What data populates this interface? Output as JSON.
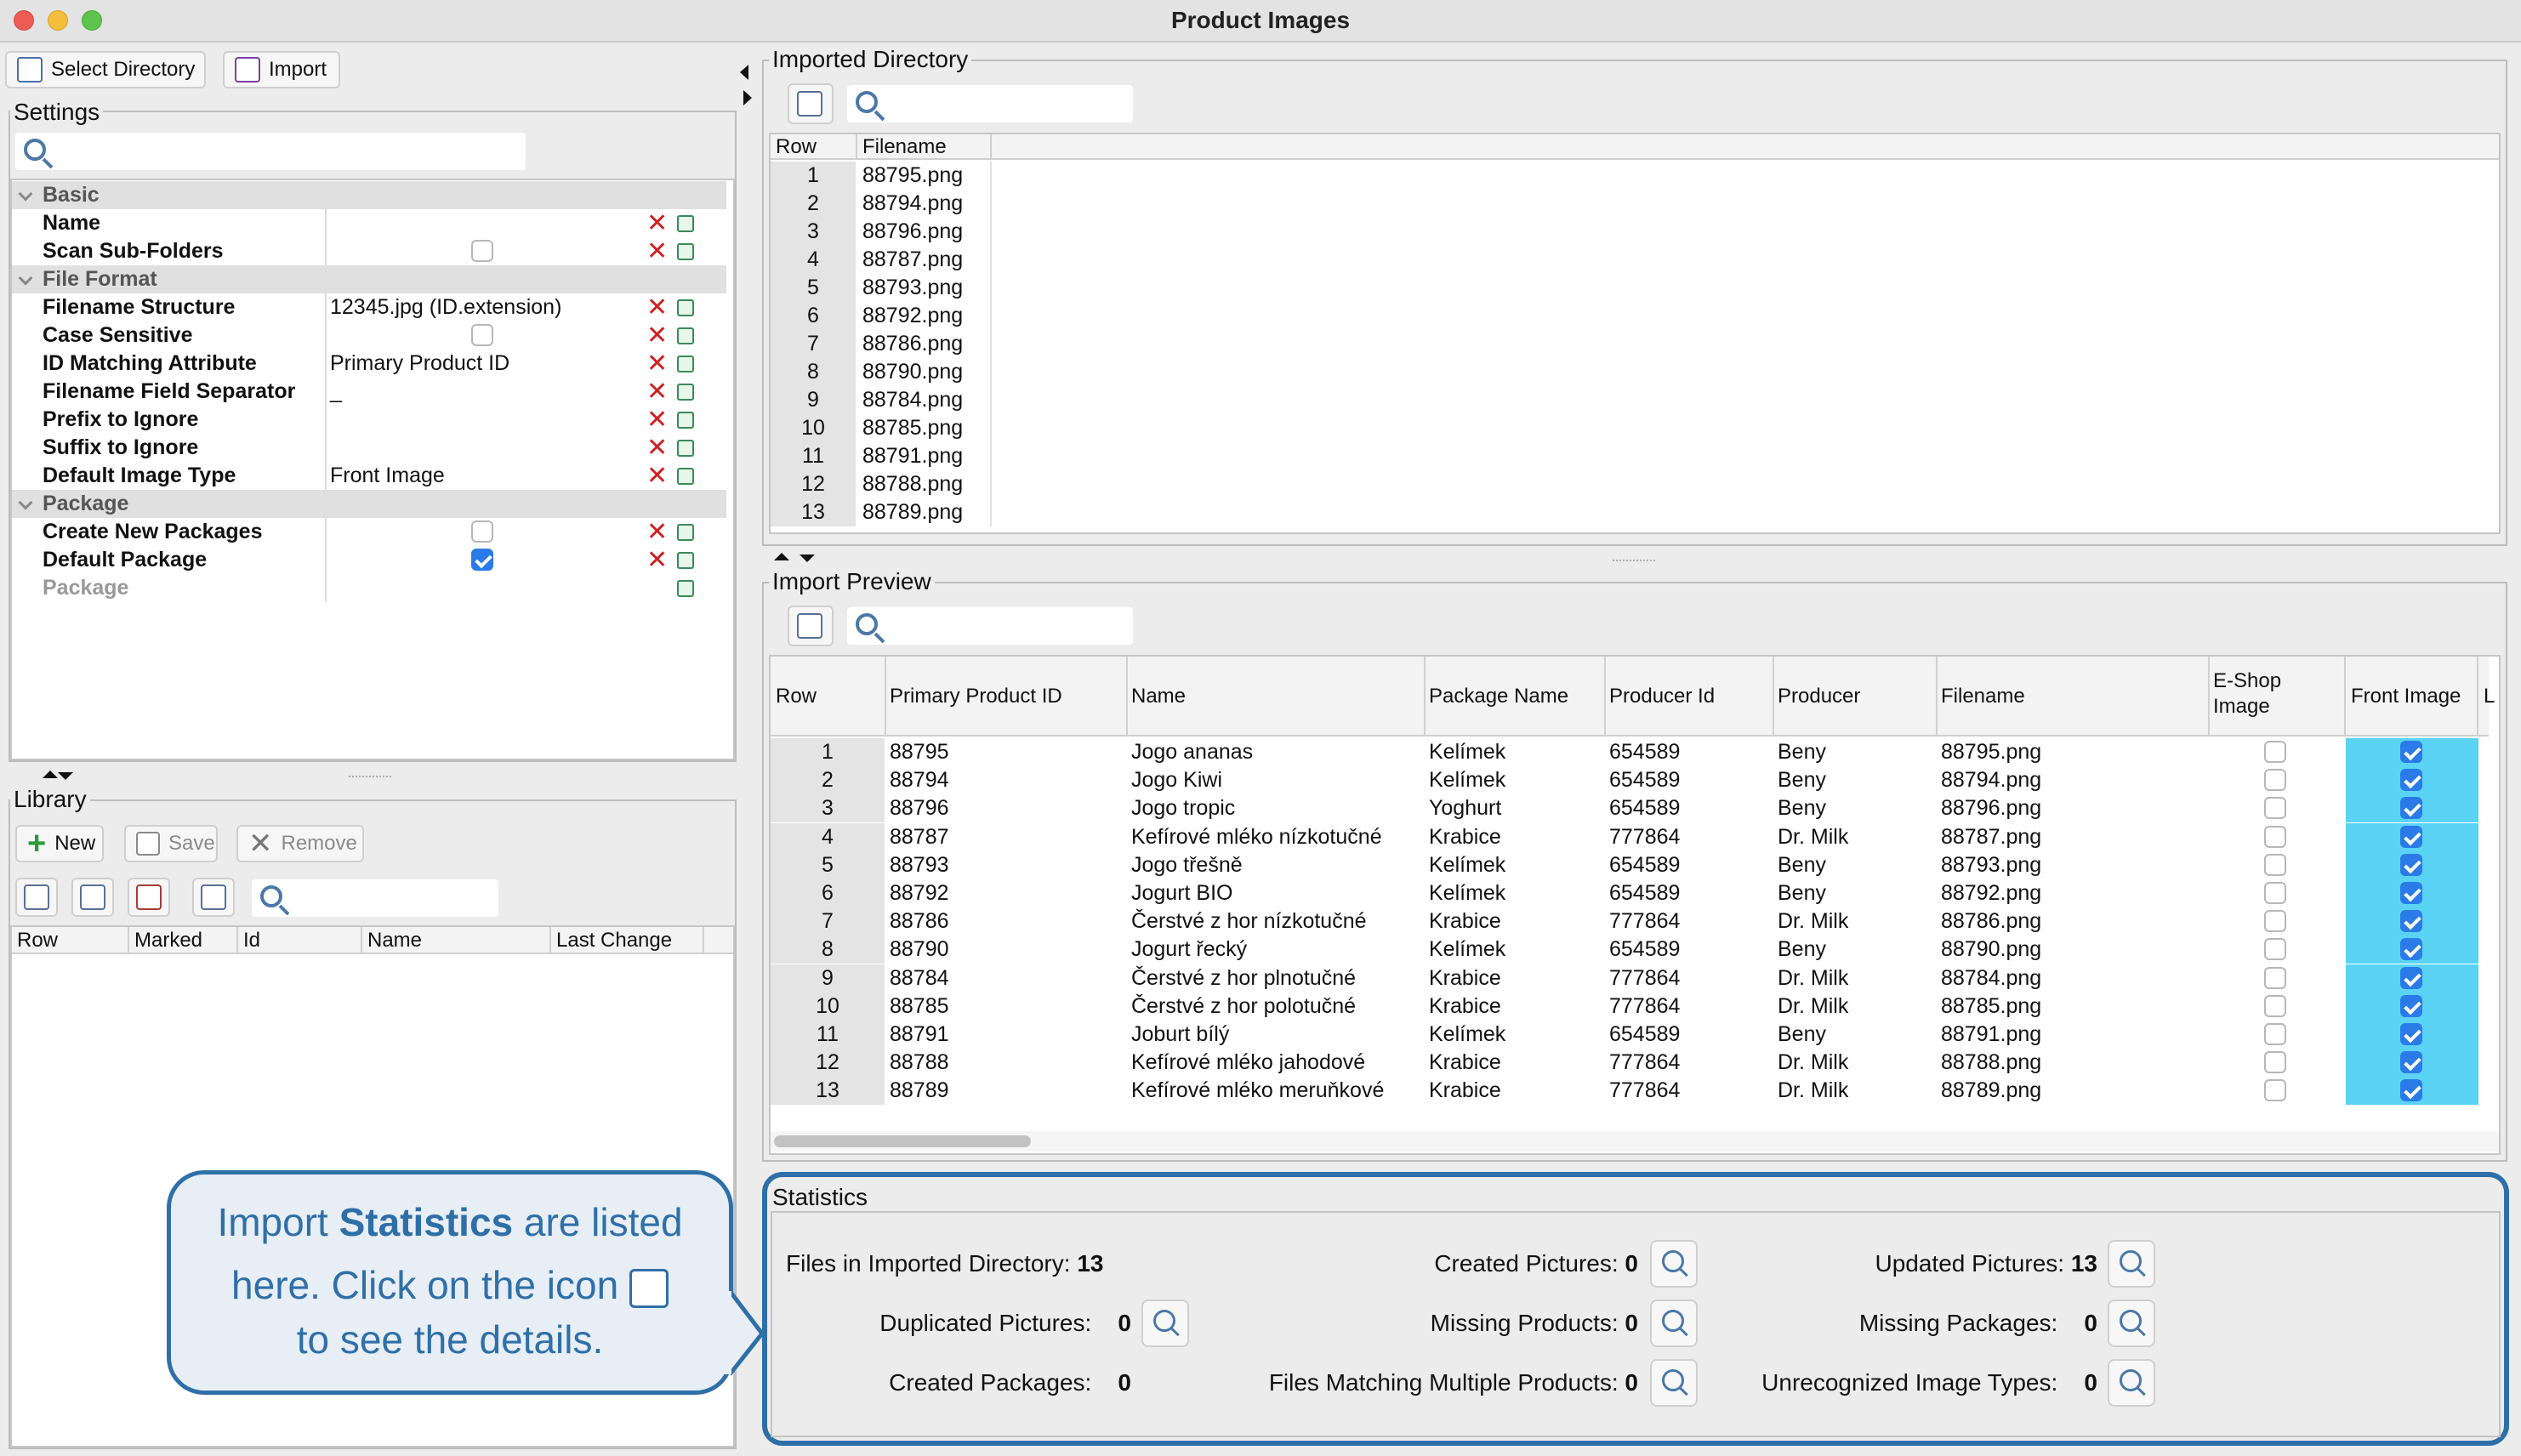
{
  "window": {
    "title": "Product Images"
  },
  "toolbar": {
    "select_directory": "Select Directory",
    "import": "Import"
  },
  "settings": {
    "title": "Settings",
    "categories": {
      "basic": "Basic",
      "file_format": "File Format",
      "package": "Package"
    },
    "rows": [
      {
        "label": "Name",
        "value": ""
      },
      {
        "label": "Scan Sub-Folders",
        "value": "",
        "checkbox": false
      },
      {
        "label": "Filename Structure",
        "value": "12345.jpg (ID.extension)"
      },
      {
        "label": "Case Sensitive",
        "value": "",
        "checkbox": false
      },
      {
        "label": "ID Matching Attribute",
        "value": "Primary Product ID"
      },
      {
        "label": "Filename Field Separator",
        "value": "_"
      },
      {
        "label": "Prefix to Ignore",
        "value": ""
      },
      {
        "label": "Suffix to Ignore",
        "value": ""
      },
      {
        "label": "Default Image Type",
        "value": "Front Image"
      },
      {
        "label": "Create New Packages",
        "value": "",
        "checkbox": false
      },
      {
        "label": "Default Package",
        "value": "",
        "checkbox": true
      },
      {
        "label": "Package",
        "value": ""
      }
    ]
  },
  "library": {
    "title": "Library",
    "new": "New",
    "save": "Save",
    "remove": "Remove",
    "columns": [
      "Row",
      "Marked",
      "Id",
      "Name",
      "Last Change"
    ]
  },
  "imported_directory": {
    "title": "Imported Directory",
    "columns": [
      "Row",
      "Filename"
    ],
    "rows": [
      [
        "1",
        "88795.png"
      ],
      [
        "2",
        "88794.png"
      ],
      [
        "3",
        "88796.png"
      ],
      [
        "4",
        "88787.png"
      ],
      [
        "5",
        "88793.png"
      ],
      [
        "6",
        "88792.png"
      ],
      [
        "7",
        "88786.png"
      ],
      [
        "8",
        "88790.png"
      ],
      [
        "9",
        "88784.png"
      ],
      [
        "10",
        "88785.png"
      ],
      [
        "11",
        "88791.png"
      ],
      [
        "12",
        "88788.png"
      ],
      [
        "13",
        "88789.png"
      ]
    ]
  },
  "import_preview": {
    "title": "Import Preview",
    "columns": [
      "Row",
      "Primary Product ID",
      "Name",
      "Package Name",
      "Producer Id",
      "Producer",
      "Filename",
      "E-Shop Image",
      "Front Image",
      "L"
    ],
    "eshop_lines": [
      "E-Shop",
      "Image"
    ],
    "rows": [
      [
        "1",
        "88795",
        "Jogo ananas",
        "Kelímek",
        "654589",
        "Beny",
        "88795.png"
      ],
      [
        "2",
        "88794",
        "Jogo Kiwi",
        "Kelímek",
        "654589",
        "Beny",
        "88794.png"
      ],
      [
        "3",
        "88796",
        "Jogo tropic",
        "Yoghurt",
        "654589",
        "Beny",
        "88796.png"
      ],
      [
        "4",
        "88787",
        "Kefírové mléko nízkotučné",
        "Krabice",
        "777864",
        "Dr. Milk",
        "88787.png"
      ],
      [
        "5",
        "88793",
        "Jogo třešně",
        "Kelímek",
        "654589",
        "Beny",
        "88793.png"
      ],
      [
        "6",
        "88792",
        "Jogurt BIO",
        "Kelímek",
        "654589",
        "Beny",
        "88792.png"
      ],
      [
        "7",
        "88786",
        "Čerstvé z hor nízkotučné",
        "Krabice",
        "777864",
        "Dr. Milk",
        "88786.png"
      ],
      [
        "8",
        "88790",
        "Jogurt řecký",
        "Kelímek",
        "654589",
        "Beny",
        "88790.png"
      ],
      [
        "9",
        "88784",
        "Čerstvé z hor plnotučné",
        "Krabice",
        "777864",
        "Dr. Milk",
        "88784.png"
      ],
      [
        "10",
        "88785",
        "Čerstvé z hor polotučné",
        "Krabice",
        "777864",
        "Dr. Milk",
        "88785.png"
      ],
      [
        "11",
        "88791",
        "Joburt bílý",
        "Kelímek",
        "654589",
        "Beny",
        "88791.png"
      ],
      [
        "12",
        "88788",
        "Kefírové mléko jahodové",
        "Krabice",
        "777864",
        "Dr. Milk",
        "88788.png"
      ],
      [
        "13",
        "88789",
        "Kefírové mléko meruňkové",
        "Krabice",
        "777864",
        "Dr. Milk",
        "88789.png"
      ]
    ]
  },
  "statistics": {
    "title": "Statistics",
    "files_in_dir": {
      "label": "Files in Imported Directory:",
      "value": "13"
    },
    "created_pictures": {
      "label": "Created Pictures:",
      "value": "0"
    },
    "updated_pictures": {
      "label": "Updated Pictures:",
      "value": "13"
    },
    "duplicated_pictures": {
      "label": "Duplicated Pictures:",
      "value": "0"
    },
    "missing_products": {
      "label": "Missing Products:",
      "value": "0"
    },
    "missing_packages": {
      "label": "Missing Packages:",
      "value": "0"
    },
    "created_packages": {
      "label": "Created Packages:",
      "value": "0"
    },
    "files_matching_multiple": {
      "label": "Files Matching Multiple Products:",
      "value": "0"
    },
    "unrecognized_image_types": {
      "label": "Unrecognized Image Types:",
      "value": "0"
    }
  },
  "callout": {
    "line1a": "Import ",
    "line1b": "Statistics",
    "line1c": " are listed",
    "line2": "here. Click on the icon",
    "line3": "to see the details."
  },
  "colors": {
    "accent": "#2f6fa8",
    "front_image_bg": "#5ad3f5",
    "checkbox_on": "#2a7be8"
  }
}
